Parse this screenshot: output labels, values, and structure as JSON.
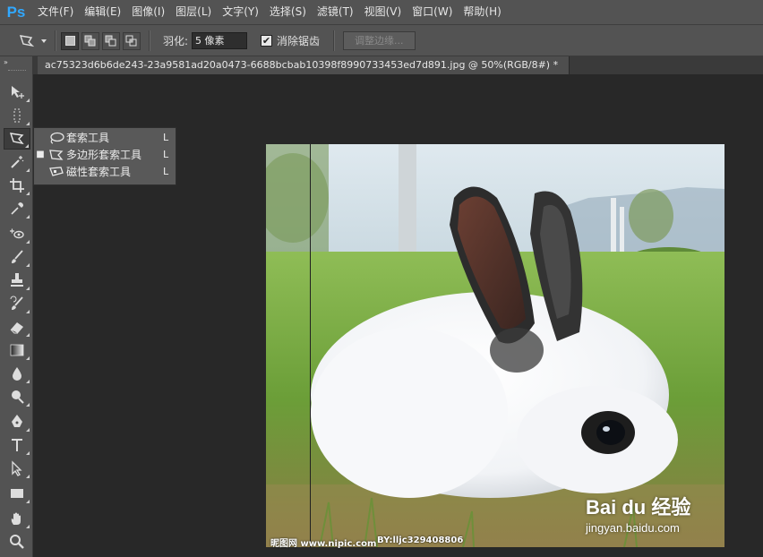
{
  "app": {
    "logo": "Ps"
  },
  "menu": [
    "文件(F)",
    "编辑(E)",
    "图像(I)",
    "图层(L)",
    "文字(Y)",
    "选择(S)",
    "滤镜(T)",
    "视图(V)",
    "窗口(W)",
    "帮助(H)"
  ],
  "options": {
    "feather_label": "羽化:",
    "feather_value": "5 像素",
    "antialias_label": "消除锯齿",
    "antialias_checked": true,
    "refine_edge_label": "调整边缘..."
  },
  "document": {
    "tab_title": "ac75323d6b6de243-23a9581ad20a0473-6688bcbab10398f8990733453ed7d891.jpg @ 50%(RGB/8#) *"
  },
  "flyout": {
    "items": [
      {
        "label": "套索工具",
        "key": "L",
        "selected": false,
        "icon": "lasso-icon"
      },
      {
        "label": "多边形套索工具",
        "key": "L",
        "selected": true,
        "icon": "polygonal-lasso-icon"
      },
      {
        "label": "磁性套索工具",
        "key": "L",
        "selected": false,
        "icon": "magnetic-lasso-icon"
      }
    ]
  },
  "watermarks": {
    "nipic": "昵图网 www.nipic.com",
    "author": "BY:lljc329408806",
    "baidu_main": "Bai du 经验",
    "baidu_sub": "jingyan.baidu.com"
  },
  "colors": {
    "ps_blue": "#31a8ff",
    "ui_gray": "#535353",
    "canvas_bg": "#282828"
  }
}
